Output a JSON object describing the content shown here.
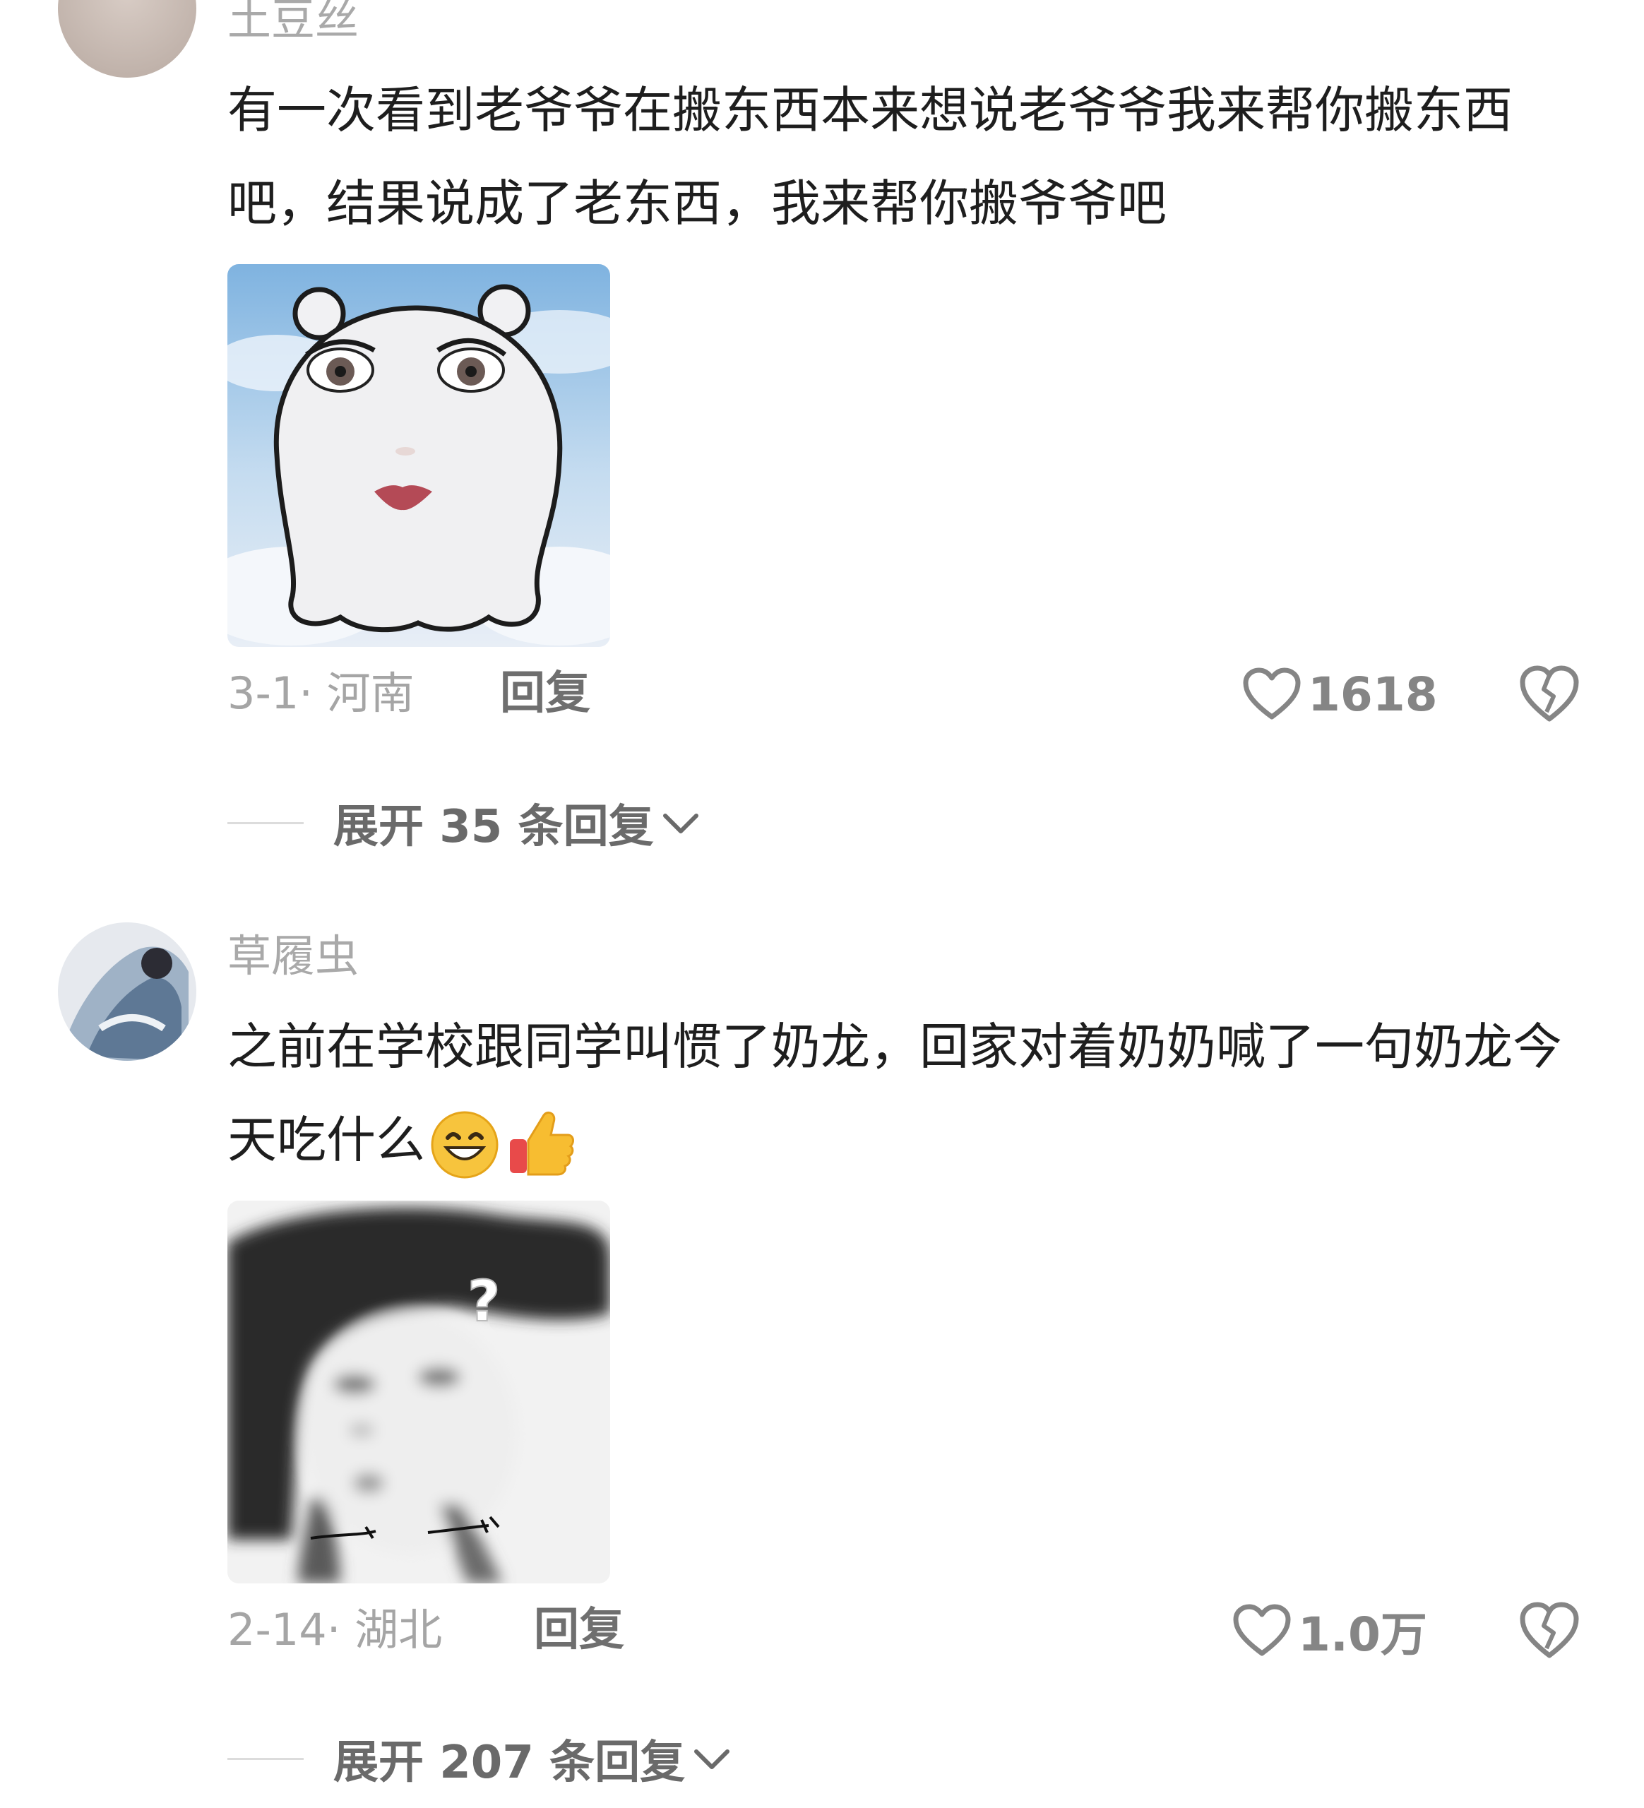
{
  "comments": [
    {
      "username": "土豆丝",
      "text": "有一次看到老爷爷在搬东西本来想说老爷爷我来帮你搬东西吧，结果说成了老东西，我来帮你搬爷爷吧",
      "date_location": "3-1· 河南",
      "reply_label": "回复",
      "likes": "1618",
      "expand_label": "展开 35 条回复",
      "avatar_color": "#c9bcb4"
    },
    {
      "username": "草履虫",
      "text": "之前在学校跟同学叫惯了奶龙，回家对着奶奶喊了一句奶龙今天吃什么",
      "emojis": [
        "grin-emoji",
        "thumbs-up-emoji"
      ],
      "date_location": "2-14· 湖北",
      "reply_label": "回复",
      "likes": "1.0万",
      "expand_label": "展开 207 条回复",
      "avatar_color": "#7e93ab"
    }
  ],
  "icons": {
    "like": "heart-outline-icon",
    "dislike": "broken-heart-icon",
    "expand": "chevron-down-icon"
  },
  "colors": {
    "text": "#1e1e1e",
    "muted": "#a9a9a9",
    "background": "#ffffff"
  }
}
